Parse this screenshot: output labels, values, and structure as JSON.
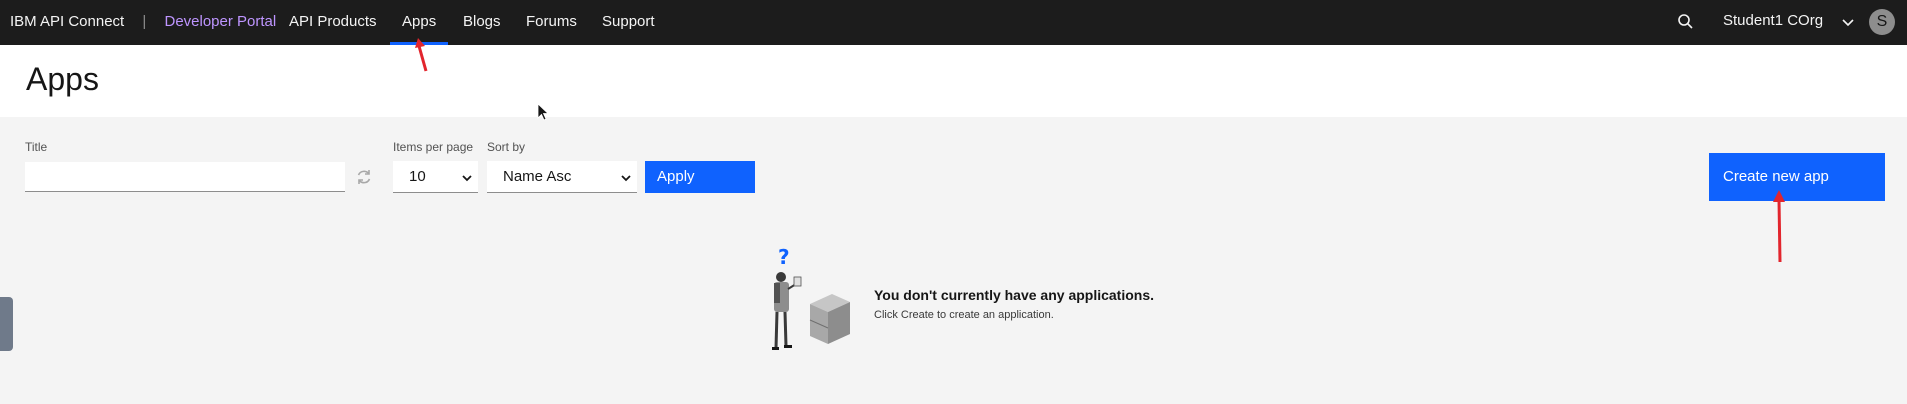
{
  "header": {
    "brand": "IBM API Connect",
    "separator": "|",
    "portal": "Developer Portal",
    "nav": [
      {
        "label": "API Products"
      },
      {
        "label": "Apps"
      },
      {
        "label": "Blogs"
      },
      {
        "label": "Forums"
      },
      {
        "label": "Support"
      }
    ],
    "active_nav": "Apps",
    "user": "Student1 COrg",
    "avatar_initial": "S"
  },
  "page": {
    "title": "Apps"
  },
  "filters": {
    "title_label": "Title",
    "title_value": "",
    "items_label": "Items per page",
    "items_value": "10",
    "sort_label": "Sort by",
    "sort_value": "Name Asc",
    "apply_label": "Apply"
  },
  "actions": {
    "create_label": "Create new app"
  },
  "empty_state": {
    "heading": "You don't currently have any applications.",
    "message": "Click Create to create an application."
  },
  "colors": {
    "topbar": "#1c1c1c",
    "primary": "#0f62fe",
    "portal_link": "#be95ff",
    "annotation_arrow": "#e2252d",
    "page_background": "#f4f4f4"
  },
  "icons": [
    "search-icon",
    "chevron-down-icon",
    "refresh-icon",
    "caret-down-icon",
    "question-mark-icon"
  ]
}
